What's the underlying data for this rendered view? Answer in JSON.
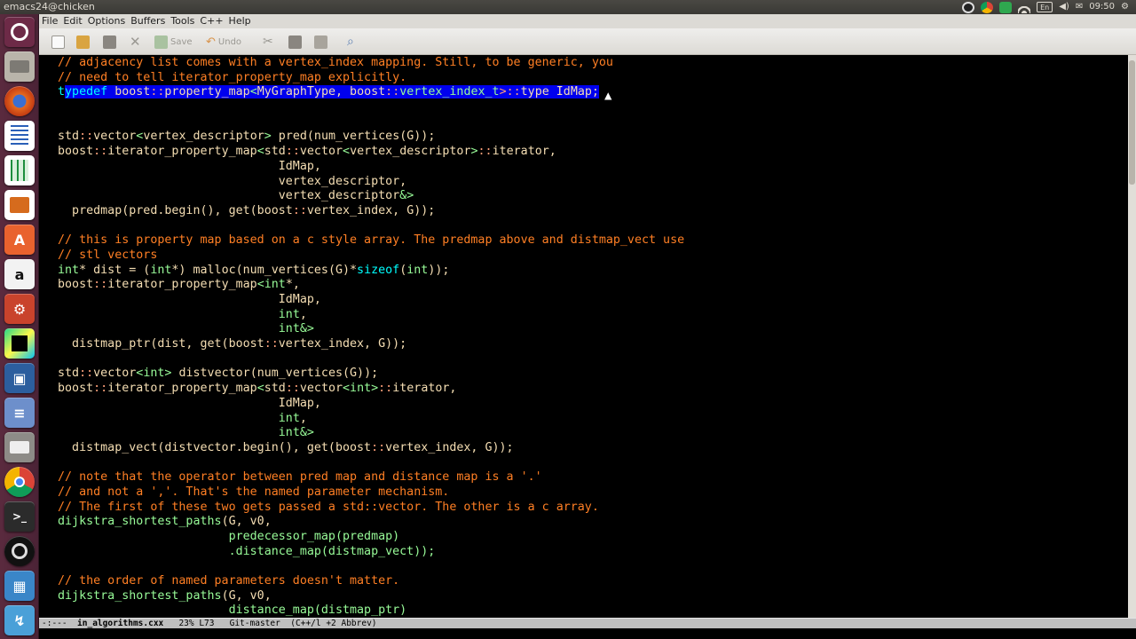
{
  "window": {
    "title": "emacs24@chicken"
  },
  "panel": {
    "lang": "En",
    "clock": "09:50"
  },
  "menubar": {
    "items": [
      "File",
      "Edit",
      "Options",
      "Buffers",
      "Tools",
      "C++",
      "Help"
    ]
  },
  "toolbar": {
    "save_label": "Save",
    "undo_label": "Undo"
  },
  "launcher": {
    "icons": [
      "ubuntu-dash-icon",
      "files-icon",
      "firefox-icon",
      "writer-icon",
      "calc-icon",
      "impress-icon",
      "software-center-icon",
      "amazon-icon",
      "system-settings-icon",
      "pycharm-icon",
      "virtualbox-icon",
      "pinta-icon",
      "printer-icon",
      "chrome-icon",
      "terminal-icon",
      "obs-icon",
      "workspaces-icon",
      "cursor-icon",
      "trash-icon"
    ]
  },
  "code": {
    "lines": [
      [
        {
          "c": "c",
          "t": "// adjacency list comes with a vertex_index mapping. Still, to be generic, you"
        }
      ],
      [
        {
          "c": "c",
          "t": "// need to tell iterator_property_map explicitly."
        }
      ],
      [
        {
          "c": "k",
          "t": "t"
        },
        {
          "c": "k sel",
          "t": "ypedef"
        },
        {
          "c": "sel",
          "t": " boost"
        },
        {
          "c": "s sel",
          "t": "::"
        },
        {
          "c": "sel",
          "t": "property_map"
        },
        {
          "c": "t sel",
          "t": "<"
        },
        {
          "c": "sel",
          "t": "MyGraphType, boost"
        },
        {
          "c": "s sel",
          "t": "::"
        },
        {
          "c": "t sel",
          "t": "vertex_index_t"
        },
        {
          "c": "s sel",
          "t": ">::"
        },
        {
          "c": "sel",
          "t": "type IdMap;"
        }
      ],
      [],
      [],
      [
        {
          "c": "",
          "t": "std"
        },
        {
          "c": "s",
          "t": "::"
        },
        {
          "c": "",
          "t": "vector"
        },
        {
          "c": "t",
          "t": "<"
        },
        {
          "c": "",
          "t": "vertex_descriptor"
        },
        {
          "c": "t",
          "t": ">"
        },
        {
          "c": "",
          "t": " pred(num_vertices(G));"
        }
      ],
      [
        {
          "c": "",
          "t": "boost"
        },
        {
          "c": "s",
          "t": "::"
        },
        {
          "c": "",
          "t": "iterator_property_map"
        },
        {
          "c": "t",
          "t": "<"
        },
        {
          "c": "",
          "t": "std"
        },
        {
          "c": "s",
          "t": "::"
        },
        {
          "c": "",
          "t": "vector"
        },
        {
          "c": "t",
          "t": "<"
        },
        {
          "c": "",
          "t": "vertex_descriptor"
        },
        {
          "c": "t",
          "t": ">"
        },
        {
          "c": "s",
          "t": "::"
        },
        {
          "c": "",
          "t": "iterator,"
        }
      ],
      [
        {
          "c": "",
          "t": "                               IdMap,"
        }
      ],
      [
        {
          "c": "",
          "t": "                               vertex_descriptor,"
        }
      ],
      [
        {
          "c": "",
          "t": "                               vertex_descriptor"
        },
        {
          "c": "t",
          "t": "&>"
        }
      ],
      [
        {
          "c": "",
          "t": "  predmap(pred.begin(), get(boost"
        },
        {
          "c": "s",
          "t": "::"
        },
        {
          "c": "",
          "t": "vertex_index, G));"
        }
      ],
      [],
      [
        {
          "c": "c",
          "t": "// this is property map based on a c style array. The predmap above and distmap_vect use"
        }
      ],
      [
        {
          "c": "c",
          "t": "// stl vectors"
        }
      ],
      [
        {
          "c": "t",
          "t": "int"
        },
        {
          "c": "",
          "t": "* dist = ("
        },
        {
          "c": "t",
          "t": "int"
        },
        {
          "c": "",
          "t": "*) malloc(num_vertices(G)*"
        },
        {
          "c": "k",
          "t": "sizeof"
        },
        {
          "c": "",
          "t": "("
        },
        {
          "c": "t",
          "t": "int"
        },
        {
          "c": "",
          "t": "));"
        }
      ],
      [
        {
          "c": "",
          "t": "boost"
        },
        {
          "c": "s",
          "t": "::"
        },
        {
          "c": "",
          "t": "iterator_property_map"
        },
        {
          "c": "t",
          "t": "<int"
        },
        {
          "c": "",
          "t": "*,"
        }
      ],
      [
        {
          "c": "",
          "t": "                               IdMap,"
        }
      ],
      [
        {
          "c": "",
          "t": "                               "
        },
        {
          "c": "t",
          "t": "int"
        },
        {
          "c": "",
          "t": ","
        }
      ],
      [
        {
          "c": "",
          "t": "                               "
        },
        {
          "c": "t",
          "t": "int&>"
        }
      ],
      [
        {
          "c": "",
          "t": "  distmap_ptr(dist, get(boost"
        },
        {
          "c": "s",
          "t": "::"
        },
        {
          "c": "",
          "t": "vertex_index, G));"
        }
      ],
      [],
      [
        {
          "c": "",
          "t": "std"
        },
        {
          "c": "s",
          "t": "::"
        },
        {
          "c": "",
          "t": "vector"
        },
        {
          "c": "t",
          "t": "<int>"
        },
        {
          "c": "",
          "t": " distvector(num_vertices(G));"
        }
      ],
      [
        {
          "c": "",
          "t": "boost"
        },
        {
          "c": "s",
          "t": "::"
        },
        {
          "c": "",
          "t": "iterator_property_map"
        },
        {
          "c": "t",
          "t": "<"
        },
        {
          "c": "",
          "t": "std"
        },
        {
          "c": "s",
          "t": "::"
        },
        {
          "c": "",
          "t": "vector"
        },
        {
          "c": "t",
          "t": "<int>"
        },
        {
          "c": "s",
          "t": "::"
        },
        {
          "c": "",
          "t": "iterator,"
        }
      ],
      [
        {
          "c": "",
          "t": "                               IdMap,"
        }
      ],
      [
        {
          "c": "",
          "t": "                               "
        },
        {
          "c": "t",
          "t": "int"
        },
        {
          "c": "",
          "t": ","
        }
      ],
      [
        {
          "c": "",
          "t": "                               "
        },
        {
          "c": "t",
          "t": "int&>"
        }
      ],
      [
        {
          "c": "",
          "t": "  distmap_vect(distvector.begin(), get(boost"
        },
        {
          "c": "s",
          "t": "::"
        },
        {
          "c": "",
          "t": "vertex_index, G));"
        }
      ],
      [],
      [
        {
          "c": "c",
          "t": "// note that the operator between pred map and distance map is a '.'"
        }
      ],
      [
        {
          "c": "c",
          "t": "// and not a ','. That's the named parameter mechanism."
        }
      ],
      [
        {
          "c": "c",
          "t": "// The first of these two gets passed a std::vector. The other is a c array."
        }
      ],
      [
        {
          "c": "t",
          "t": "dijkstra_shortest_paths"
        },
        {
          "c": "",
          "t": "(G, v0,"
        }
      ],
      [
        {
          "c": "t",
          "t": "                        predecessor_map(predmap)"
        }
      ],
      [
        {
          "c": "t",
          "t": "                        .distance_map(distmap_vect));"
        }
      ],
      [],
      [
        {
          "c": "c",
          "t": "// the order of named parameters doesn't matter."
        }
      ],
      [
        {
          "c": "t",
          "t": "dijkstra_shortest_paths"
        },
        {
          "c": "",
          "t": "(G, v0,"
        }
      ],
      [
        {
          "c": "t",
          "t": "                        distance_map(distmap_ptr)"
        }
      ]
    ]
  },
  "modeline": {
    "status": "-:---  ",
    "buffer": "in_algorithms.cxx",
    "position": "   23% L73",
    "vc": "   Git-master",
    "modes": "  (C++/l +2 Abbrev)"
  }
}
